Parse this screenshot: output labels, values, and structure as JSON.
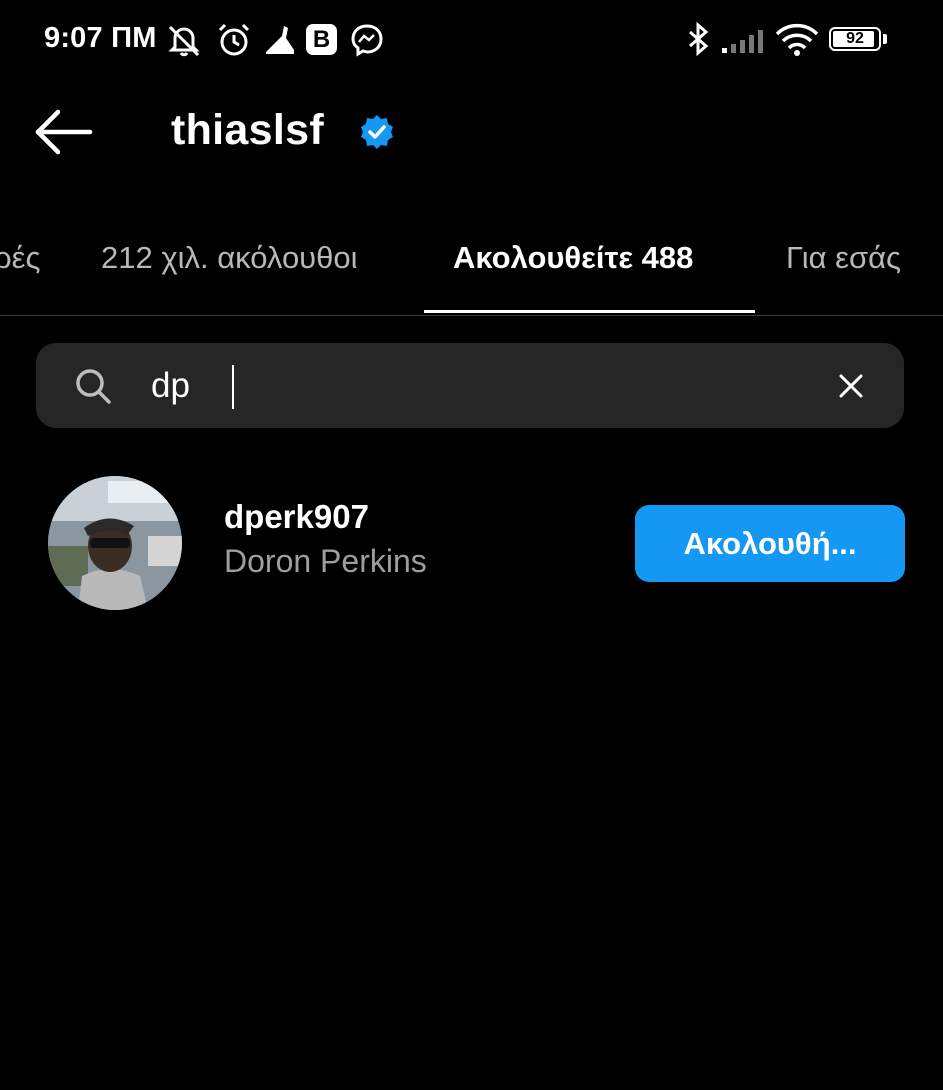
{
  "status_bar": {
    "time": "9:07 ΠΜ",
    "notification_b": "B",
    "battery_level": "92"
  },
  "header": {
    "username": "thiaslsf"
  },
  "tabs": [
    {
      "label": "ρές",
      "active": false
    },
    {
      "label": "212 χιλ. ακόλουθοι",
      "active": false
    },
    {
      "label": "Ακολουθείτε 488",
      "active": true
    },
    {
      "label": "Για εσάς",
      "active": false
    }
  ],
  "search": {
    "value": "dp"
  },
  "results": [
    {
      "username": "dperk907",
      "full_name": "Doron Perkins",
      "button_label": "Ακολουθή..."
    }
  ],
  "colors": {
    "background": "#000000",
    "accent_blue": "#1597f4",
    "search_bg": "#262626",
    "secondary_text": "#9e9e9e"
  }
}
